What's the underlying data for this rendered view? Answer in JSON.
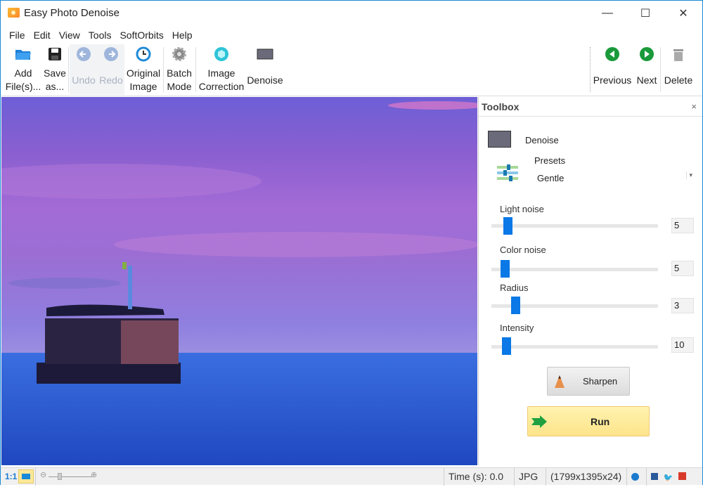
{
  "window": {
    "title": "Easy Photo Denoise",
    "minimize_glyph": "—",
    "maximize_glyph": "☐",
    "close_glyph": "✕"
  },
  "menu": [
    "File",
    "Edit",
    "View",
    "Tools",
    "SoftOrbits",
    "Help"
  ],
  "toolbar": {
    "add_files": {
      "line1": "Add",
      "line2": "File(s)...",
      "icon": "open-folder-icon"
    },
    "save_as": {
      "line1": "Save",
      "line2": "as...",
      "icon": "floppy-disk-icon"
    },
    "undo": {
      "label": "Undo",
      "icon": "undo-arrow-icon",
      "enabled": false
    },
    "redo": {
      "label": "Redo",
      "icon": "redo-arrow-icon",
      "enabled": false
    },
    "original_image": {
      "line1": "Original",
      "line2": "Image",
      "icon": "history-clock-icon"
    },
    "batch_mode": {
      "line1": "Batch",
      "line2": "Mode",
      "icon": "gear-icon"
    },
    "image_correction": {
      "line1": "Image",
      "line2": "Correction",
      "icon": "aperture-icon"
    },
    "denoise": {
      "label": "Denoise",
      "icon": "denoise-icon"
    },
    "previous": {
      "label": "Previous",
      "icon": "green-left-arrow-icon"
    },
    "next": {
      "label": "Next",
      "icon": "green-right-arrow-icon"
    },
    "delete": {
      "label": "Delete",
      "icon": "trash-icon"
    }
  },
  "toolbox": {
    "title": "Toolbox",
    "close_glyph": "×",
    "section": "Denoise",
    "presets_label": "Presets",
    "preset_value": "Gentle",
    "sliders": [
      {
        "label": "Light noise",
        "value": "5",
        "fraction": 0.05
      },
      {
        "label": "Color noise",
        "value": "5",
        "fraction": 0.03
      },
      {
        "label": "Radius",
        "value": "3",
        "fraction": 0.1
      },
      {
        "label": "Intensity",
        "value": "10",
        "fraction": 0.04
      }
    ],
    "sharpen_label": "Sharpen",
    "run_label": "Run"
  },
  "statusbar": {
    "zoom_1to1": "1:1",
    "time": "Time (s): 0.0",
    "format": "JPG",
    "dimensions": "(1799x1395x24)"
  },
  "colors": {
    "accent": "#0a78e6",
    "run_button": "#fde48a",
    "window_border": "#1a8ad4"
  }
}
